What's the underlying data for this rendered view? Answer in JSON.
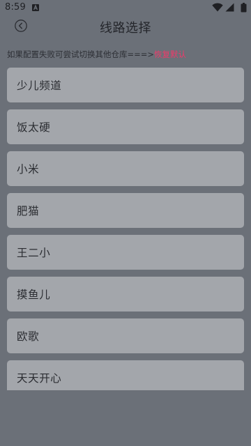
{
  "status_bar": {
    "time": "8:59"
  },
  "header": {
    "title": "线路选择"
  },
  "notice": {
    "text": "如果配置失败可尝试切换其他仓库===>",
    "link_text": "恢复默认"
  },
  "routes": [
    {
      "label": "少儿频道"
    },
    {
      "label": "饭太硬"
    },
    {
      "label": "小米"
    },
    {
      "label": "肥猫"
    },
    {
      "label": "王二小"
    },
    {
      "label": "摸鱼儿"
    },
    {
      "label": "欧歌"
    },
    {
      "label": "天天开心"
    }
  ],
  "colors": {
    "background": "#6b7078",
    "item_background": "#a3a6ab",
    "link": "#ef3a6a"
  }
}
